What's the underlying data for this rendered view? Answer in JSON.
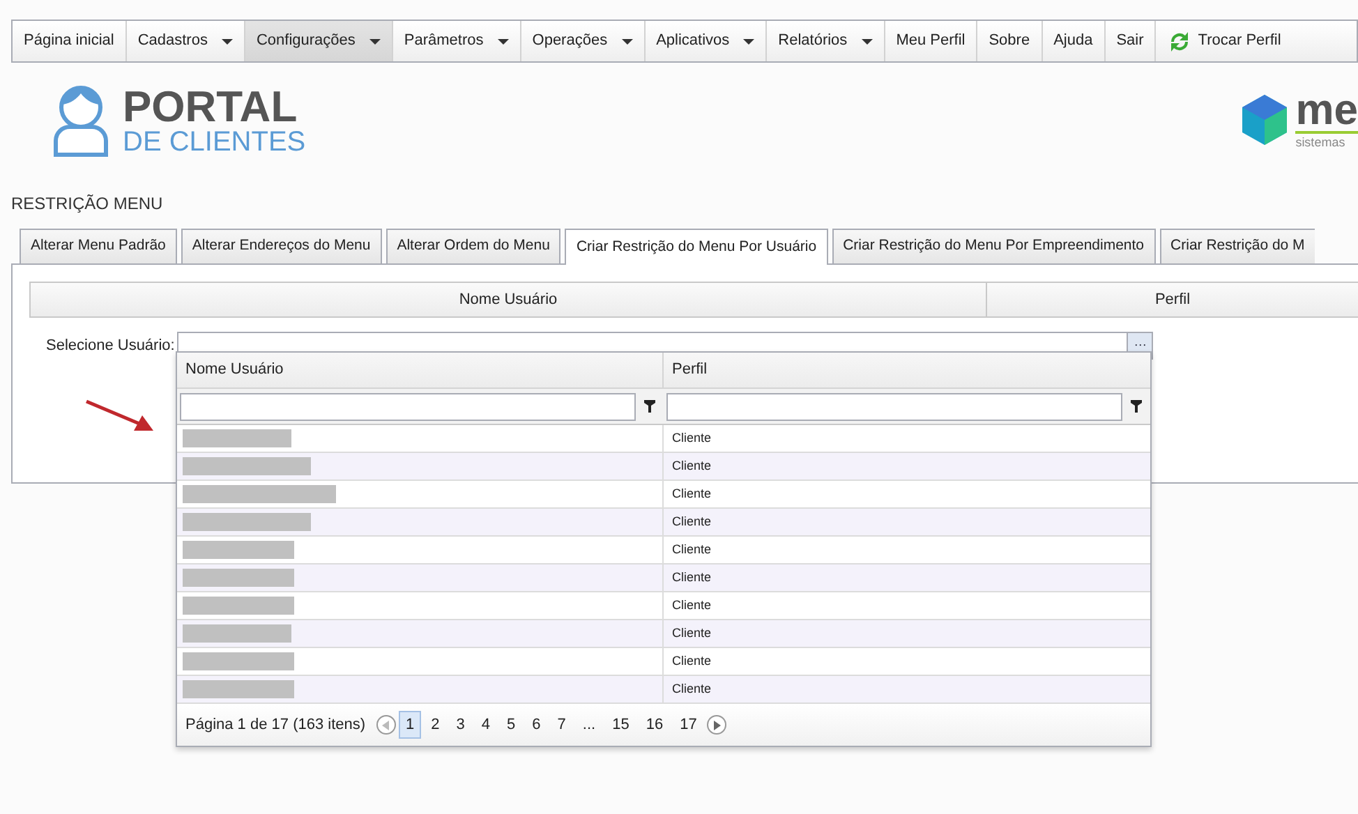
{
  "menu": [
    {
      "label": "Página inicial",
      "kind": "link",
      "selected": false
    },
    {
      "label": "Cadastros",
      "kind": "dropdown",
      "selected": false
    },
    {
      "label": "Configurações",
      "kind": "dropdown",
      "selected": true
    },
    {
      "label": "Parâmetros",
      "kind": "dropdown",
      "selected": false
    },
    {
      "label": "Operações",
      "kind": "dropdown",
      "selected": false
    },
    {
      "label": "Aplicativos",
      "kind": "dropdown",
      "selected": false
    },
    {
      "label": "Relatórios",
      "kind": "dropdown",
      "selected": false
    },
    {
      "label": "Meu Perfil",
      "kind": "link",
      "selected": false
    },
    {
      "label": "Sobre",
      "kind": "link",
      "selected": false
    },
    {
      "label": "Ajuda",
      "kind": "link",
      "selected": false
    },
    {
      "label": "Sair",
      "kind": "link",
      "selected": false
    },
    {
      "label": "Trocar Perfil",
      "kind": "refresh",
      "selected": false
    }
  ],
  "logo": {
    "line_1": "PORTAL",
    "line_2": "DE CLIENTES"
  },
  "brand_logo": {
    "text": "me",
    "subtitle": "sistemas"
  },
  "page_title": "RESTRIÇÃO MENU",
  "tabs": [
    {
      "label": "Alterar Menu Padrão",
      "selected": false
    },
    {
      "label": "Alterar Endereços do Menu",
      "selected": false
    },
    {
      "label": "Alterar Ordem do Menu",
      "selected": false
    },
    {
      "label": "Criar Restrição do Menu Por Usuário",
      "selected": true
    },
    {
      "label": "Criar Restrição do Menu Por Empreendimento",
      "selected": false
    },
    {
      "label": "Criar Restrição do M",
      "selected": false
    }
  ],
  "grid": {
    "columns": [
      "Nome Usuário",
      "Perfil"
    ]
  },
  "user_select": {
    "label": "Selecione Usuário:",
    "button": "···"
  },
  "dropdown": {
    "columns": [
      "Nome Usuário",
      "Perfil"
    ],
    "rows": [
      {
        "perfil": "Cliente"
      },
      {
        "perfil": "Cliente"
      },
      {
        "perfil": "Cliente"
      },
      {
        "perfil": "Cliente"
      },
      {
        "perfil": "Cliente"
      },
      {
        "perfil": "Cliente"
      },
      {
        "perfil": "Cliente"
      },
      {
        "perfil": "Cliente"
      },
      {
        "perfil": "Cliente"
      },
      {
        "perfil": "Cliente"
      }
    ],
    "summary": "Página 1 de 17 (163 itens)",
    "pages": [
      {
        "label": "1",
        "selected": true
      },
      {
        "label": "2",
        "selected": false
      },
      {
        "label": "3",
        "selected": false
      },
      {
        "label": "4",
        "selected": false
      },
      {
        "label": "5",
        "selected": false
      },
      {
        "label": "6",
        "selected": false
      },
      {
        "label": "7",
        "selected": false
      },
      {
        "label": "...",
        "selected": false
      },
      {
        "label": "15",
        "selected": false
      },
      {
        "label": "16",
        "selected": false
      },
      {
        "label": "17",
        "selected": false
      }
    ]
  }
}
